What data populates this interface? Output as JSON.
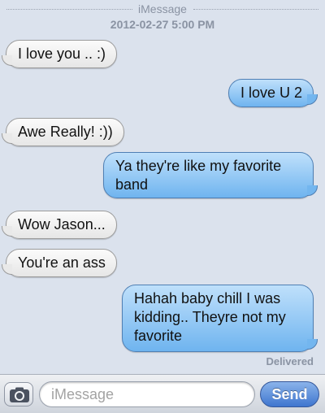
{
  "thread": {
    "service_label": "iMessage",
    "timestamp": "2012-02-27 5:00 PM",
    "status": "Delivered"
  },
  "messages": [
    {
      "direction": "incoming",
      "text": "I love you .. :)"
    },
    {
      "direction": "outgoing",
      "text": "I love U 2"
    },
    {
      "direction": "incoming",
      "text": "Awe Really! :))"
    },
    {
      "direction": "outgoing",
      "text": "Ya they're like my favorite band"
    },
    {
      "direction": "incoming",
      "text": "Wow Jason..."
    },
    {
      "direction": "incoming",
      "text": "You're an ass"
    },
    {
      "direction": "outgoing",
      "text": "Hahah baby chill I was kidding.. Theyre not my favorite"
    }
  ],
  "composer": {
    "placeholder": "iMessage",
    "value": "",
    "send_label": "Send",
    "camera_icon": "camera-icon"
  },
  "colors": {
    "background": "#dbe2ed",
    "incoming_bubble": "#efefef",
    "outgoing_bubble": "#8cc4f2",
    "send_button": "#3f76cf"
  }
}
